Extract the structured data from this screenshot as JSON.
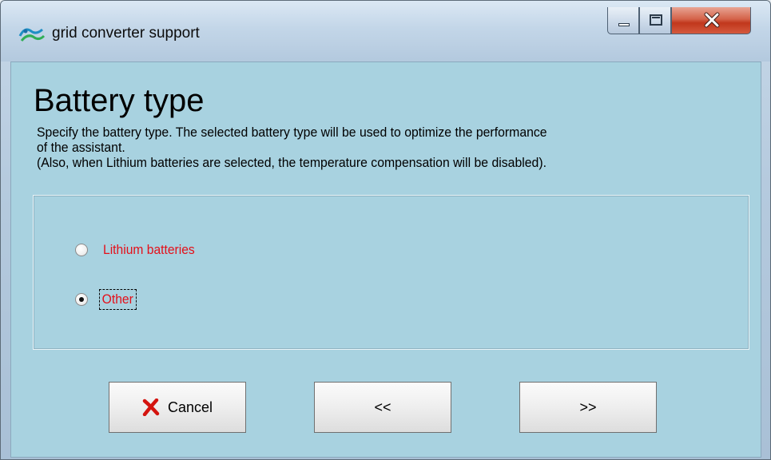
{
  "window": {
    "title": "grid converter support"
  },
  "page": {
    "title": "Battery type",
    "description_lines": [
      "Specify the battery type. The selected battery type will be used to optimize the performance",
      "of the assistant.",
      "(Also, when Lithium batteries are selected, the temperature compensation will be disabled)."
    ]
  },
  "battery_options": [
    {
      "label": "Lithium batteries",
      "selected": false
    },
    {
      "label": "Other",
      "selected": true
    }
  ],
  "buttons": {
    "cancel": "Cancel",
    "back": "<<",
    "next": ">>"
  },
  "colors": {
    "client_background": "#a8d2e0",
    "option_label": "#e4101a",
    "close_button": "#c1371c"
  },
  "icons": {
    "app": "app-logo-icon",
    "cancel": "red-x-icon",
    "minimize": "minimize-icon",
    "maximize": "maximize-icon",
    "close": "close-icon"
  }
}
